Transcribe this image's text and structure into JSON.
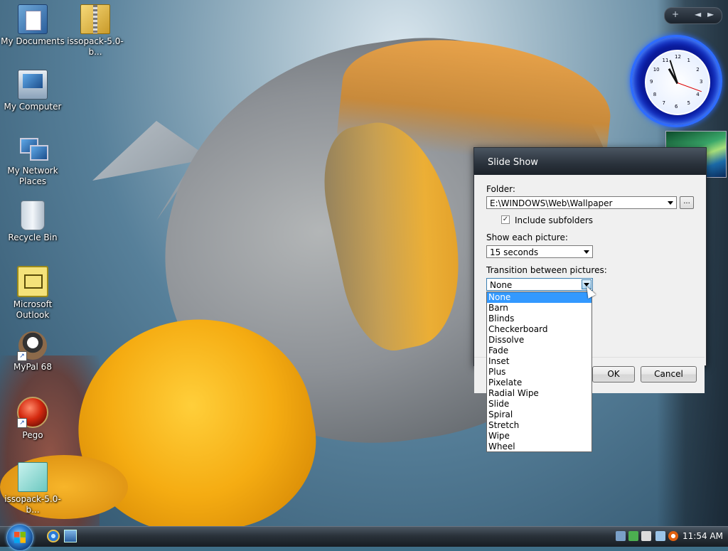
{
  "desktop": {
    "icons": [
      {
        "label": "My Documents"
      },
      {
        "label": "issopack-5.0-b..."
      },
      {
        "label": "My Computer"
      },
      {
        "label": "My Network Places"
      },
      {
        "label": "Recycle Bin"
      },
      {
        "label": "Microsoft Outlook"
      },
      {
        "label": "MyPal 68"
      },
      {
        "label": "Pego"
      },
      {
        "label": "issopack-5.0-b..."
      }
    ]
  },
  "sidebar": {
    "controls": [
      "+",
      "◄",
      "►"
    ],
    "clock_numbers": [
      "12",
      "1",
      "2",
      "3",
      "4",
      "5",
      "6",
      "7",
      "8",
      "9",
      "10",
      "11"
    ]
  },
  "dialog": {
    "title": "Slide Show",
    "folder_label": "Folder:",
    "folder_value": "E:\\WINDOWS\\Web\\Wallpaper",
    "browse_label": "...",
    "include_subfolders_label": "Include subfolders",
    "include_subfolders_checked": true,
    "show_each_label": "Show each picture:",
    "show_each_value": "15 seconds",
    "transition_label": "Transition between pictures:",
    "transition_value": "None",
    "ok_label": "OK",
    "cancel_label": "Cancel"
  },
  "transition_options": [
    "None",
    "Barn",
    "Blinds",
    "Checkerboard",
    "Dissolve",
    "Fade",
    "Inset",
    "Plus",
    "Pixelate",
    "Radial Wipe",
    "Slide",
    "Spiral",
    "Stretch",
    "Wipe",
    "Wheel"
  ],
  "taskbar": {
    "time": "11:54 AM"
  },
  "colors": {
    "selection": "#3399ff",
    "title_bar": "#2a323b",
    "clock_ring": "#2e6cff"
  }
}
